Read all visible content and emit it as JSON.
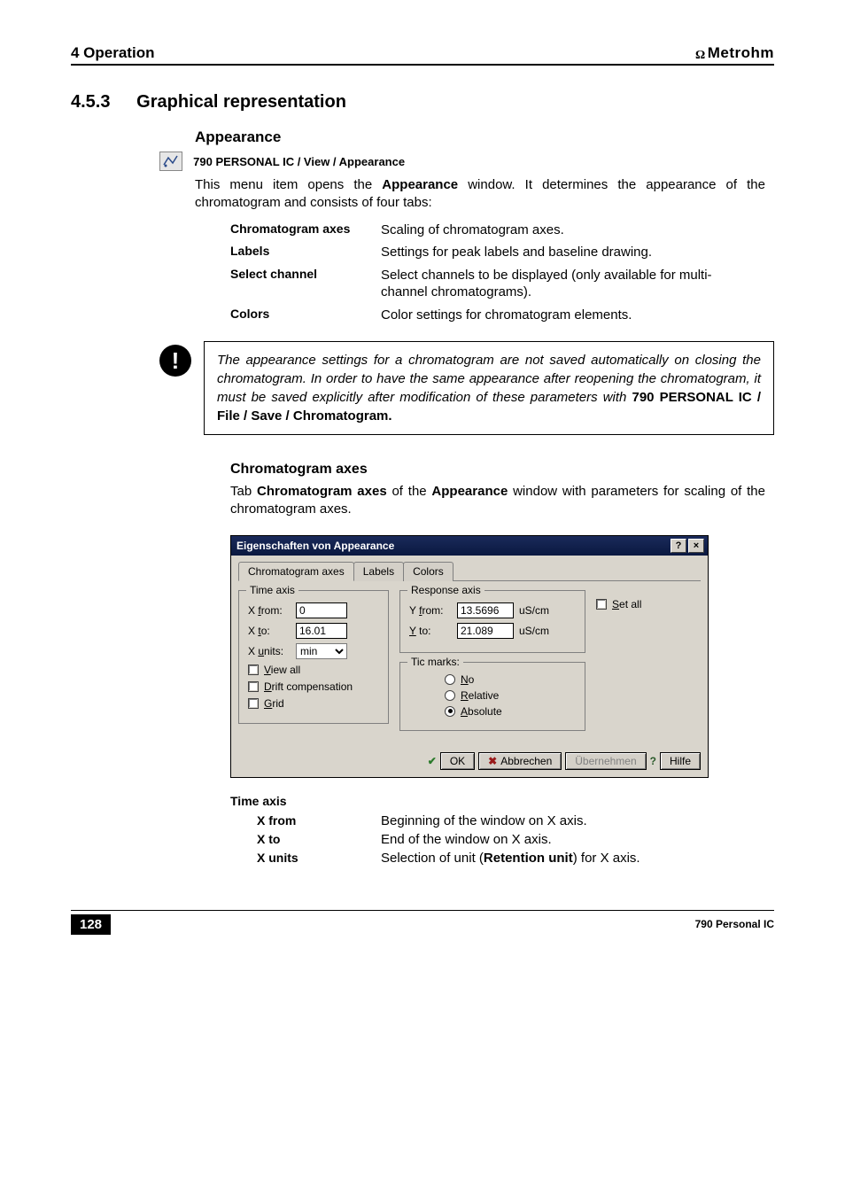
{
  "header": {
    "left": "4 Operation",
    "right": "Metrohm",
    "ohm": "Ω"
  },
  "section": {
    "num": "4.5.3",
    "title": "Graphical representation"
  },
  "appearance": {
    "heading": "Appearance",
    "breadcrumb": "790 PERSONAL IC / View / Appearance",
    "intro_pre": "This menu item opens the ",
    "intro_bold": "Appearance",
    "intro_post": " window. It determines the appearance of the chromatogram and consists of four tabs:",
    "defs": [
      {
        "term": "Chromatogram axes",
        "desc": "Scaling of chromatogram axes."
      },
      {
        "term": "Labels",
        "desc": "Settings for peak labels and baseline drawing."
      },
      {
        "term": "Select channel",
        "desc": "Select channels to be displayed (only available for multi-channel chromatograms)."
      },
      {
        "term": "Colors",
        "desc": "Color settings for chromatogram elements."
      }
    ]
  },
  "note": {
    "body": "The appearance settings for a chromatogram are not saved automatically on closing the chromatogram. In order to have the same appearance after reopening the chromatogram, it must be saved explicitly after modification of these parameters with ",
    "bold1": "790 PERSONAL IC",
    "sep": " / ",
    "bold2": "File / Save / Chromatogram",
    "period": "."
  },
  "chrom": {
    "heading": "Chromatogram axes",
    "intro_pre": "Tab ",
    "intro_b1": "Chromatogram axes",
    "intro_mid": " of the ",
    "intro_b2": "Appearance",
    "intro_post": " window with parameters for scaling of the chromatogram axes."
  },
  "dialog": {
    "title": "Eigenschaften von Appearance",
    "help_btn": "?",
    "close_btn": "×",
    "tabs": [
      "Chromatogram axes",
      "Labels",
      "Colors"
    ],
    "active_tab": 0,
    "time_group": "Time axis",
    "xfrom_label": "X from:",
    "xfrom_u": "f",
    "xfrom_val": "0",
    "xto_label": "X to:",
    "xto_u": "t",
    "xto_val": "16.01",
    "xunits_label": "X units:",
    "xunits_u": "u",
    "xunits_val": "min",
    "viewall": "View all",
    "viewall_u": "V",
    "drift": "Drift compensation",
    "drift_u": "D",
    "grid": "Grid",
    "grid_u": "G",
    "resp_group": "Response axis",
    "yfrom_label": "Y from:",
    "yfrom_u": "f",
    "yfrom_val": "13.5696",
    "yfrom_unit": "uS/cm",
    "yto_label": "Y to:",
    "yto_u": "Y",
    "yto_val": "21.089",
    "yto_unit": "uS/cm",
    "tic_group": "Tic marks:",
    "tic_no": "No",
    "tic_no_u": "N",
    "tic_rel": "Relative",
    "tic_rel_u": "R",
    "tic_abs": "Absolute",
    "tic_abs_u": "A",
    "tic_selected": "abs",
    "setall": "Set all",
    "setall_u": "S",
    "ok": "OK",
    "cancel": "Abbrechen",
    "apply": "Übernehmen",
    "help": "Hilfe"
  },
  "timeaxis": {
    "heading": "Time axis",
    "rows": [
      {
        "term": "X from",
        "desc_pre": "Beginning of the window on X axis.",
        "desc_bold": "",
        "desc_post": ""
      },
      {
        "term": "X to",
        "desc_pre": "End of the window on X axis.",
        "desc_bold": "",
        "desc_post": ""
      },
      {
        "term": "X units",
        "desc_pre": "Selection of unit (",
        "desc_bold": "Retention unit",
        "desc_post": ") for X axis."
      }
    ]
  },
  "footer": {
    "page": "128",
    "right": "790 Personal IC"
  }
}
